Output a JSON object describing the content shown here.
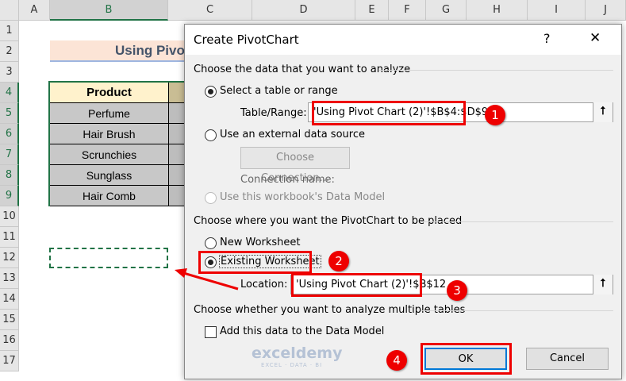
{
  "sheet": {
    "columns": [
      "A",
      "B",
      "C",
      "D",
      "E",
      "F",
      "G",
      "H",
      "I",
      "J"
    ],
    "rows": [
      "1",
      "2",
      "3",
      "4",
      "5",
      "6",
      "7",
      "8",
      "9",
      "10",
      "11",
      "12",
      "13",
      "14",
      "15",
      "16",
      "17"
    ],
    "title_cell": "Using Pivot Chart",
    "table_header": "Product",
    "products": [
      "Perfume",
      "Hair Brush",
      "Scrunchies",
      "Sunglass",
      "Hair Comb"
    ]
  },
  "dialog": {
    "title": "Create PivotChart",
    "help": "?",
    "close": "✕",
    "section1": "Choose the data that you want to analyze",
    "opt_select_range": "Select a table or range",
    "table_range_label": "Table/Range:",
    "table_range_value": "'Using Pivot Chart (2)'!$B$4:$D$9",
    "opt_external": "Use an external data source",
    "choose_connection": "Choose Connection...",
    "connection_name": "Connection name:",
    "opt_data_model": "Use this workbook's Data Model",
    "section2": "Choose where you want the PivotChart to be placed",
    "opt_new_ws": "New Worksheet",
    "opt_existing_ws": "Existing Worksheet",
    "location_label": "Location:",
    "location_value": "'Using Pivot Chart (2)'!$B$12",
    "section3": "Choose whether you want to analyze multiple tables",
    "add_data_model": "Add this data to the Data Model",
    "ok": "OK",
    "cancel": "Cancel",
    "collapse_icon": "⭡"
  },
  "annotations": [
    "1",
    "2",
    "3",
    "4"
  ],
  "watermark": {
    "name": "exceldemy",
    "tagline": "EXCEL · DATA · BI"
  },
  "colors": {
    "accent": "#217346",
    "annotation": "#ee0000",
    "title_fill": "#fce4d6",
    "header_fill": "#fff2cc"
  }
}
